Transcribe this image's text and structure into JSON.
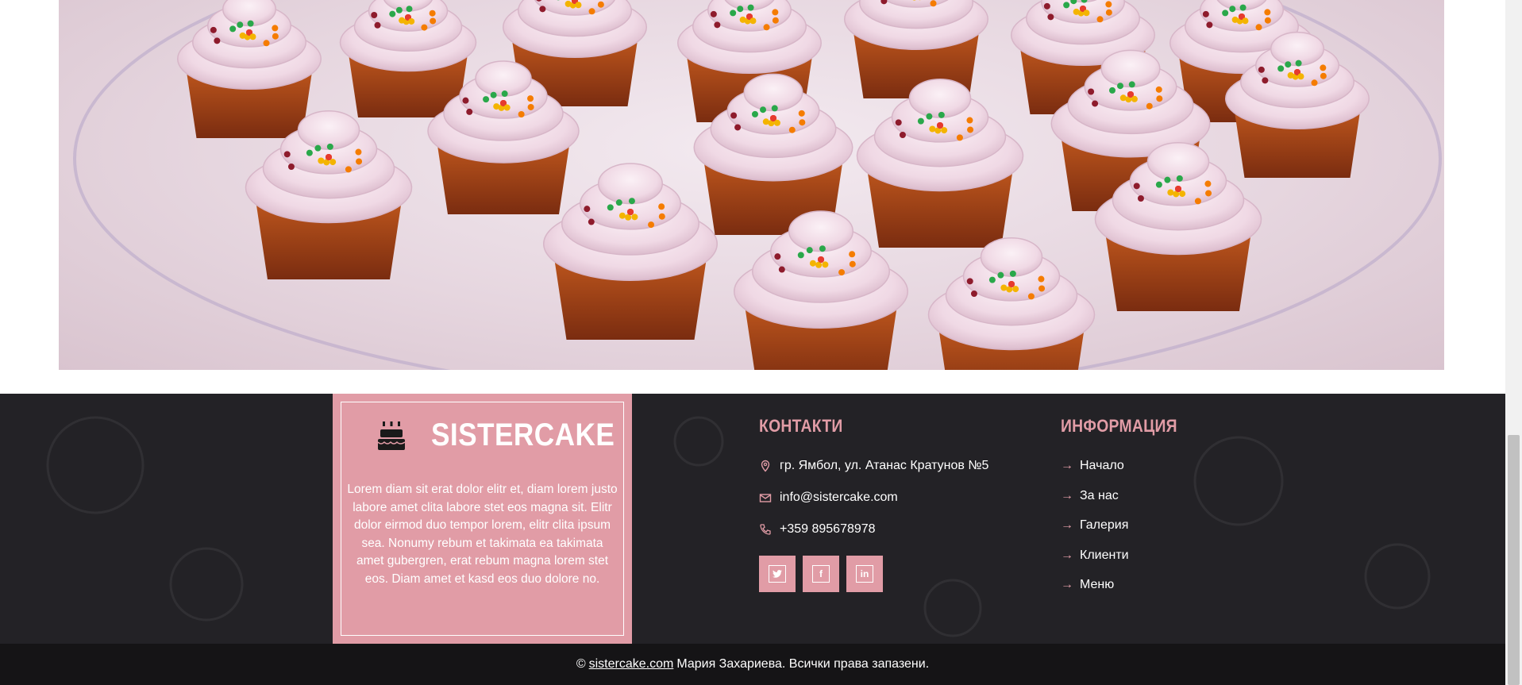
{
  "hero_image": {
    "alt_icon": "cupcakes-photo"
  },
  "brand": {
    "name": "SISTERCAKE",
    "icon": "birthday-cake-icon",
    "description": "Lorem diam sit erat dolor elitr et, diam lorem justo labore amet clita labore stet eos magna sit. Elitr dolor eirmod duo tempor lorem, elitr clita ipsum sea. Nonumy rebum et takimata ea takimata amet gubergren, erat rebum magna lorem stet eos. Diam amet et kasd eos duo dolore no."
  },
  "contacts": {
    "title": "КОНТАКТИ",
    "address": "гр. Ямбол, ул. Атанас Кратунов №5",
    "email": "info@sistercake.com",
    "phone": "+359 895678978",
    "social": [
      {
        "name": "twitter",
        "icon": "twitter-icon",
        "glyph": "🐦"
      },
      {
        "name": "facebook",
        "icon": "facebook-icon",
        "glyph": "f"
      },
      {
        "name": "linkedin",
        "icon": "linkedin-icon",
        "glyph": "in"
      }
    ]
  },
  "info": {
    "title": "ИНФОРМАЦИЯ",
    "links": [
      "Начало",
      "За нас",
      "Галерия",
      "Клиенти",
      "Меню"
    ]
  },
  "copyright": {
    "prefix": "©",
    "site": "sistercake.com",
    "suffix": "Мария Захариева. Всички права запазени."
  },
  "colors": {
    "accent": "#e19ca6",
    "footer_bg": "#232226",
    "copyright_bg": "#151416"
  }
}
